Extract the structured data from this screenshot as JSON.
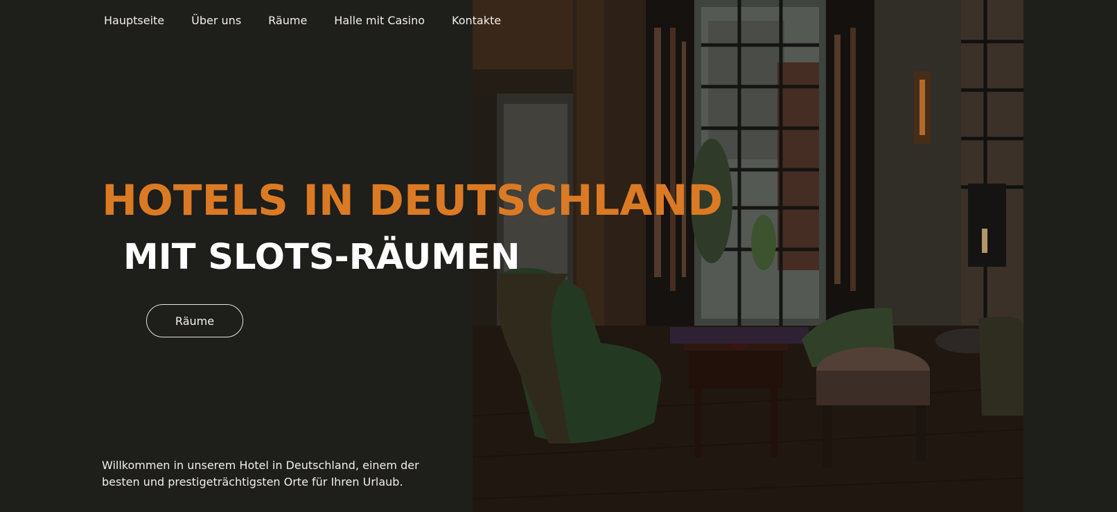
{
  "nav": {
    "items": [
      {
        "label": "Hauptseite"
      },
      {
        "label": "Über uns"
      },
      {
        "label": "Räume"
      },
      {
        "label": "Halle mit Casino"
      },
      {
        "label": "Kontakte"
      }
    ]
  },
  "hero": {
    "title_line1": "HOTELS IN DEUTSCHLAND",
    "title_line2": "MIT SLOTS-RÄUMEN",
    "cta_label": "Räume",
    "intro": "Willkommen in unserem Hotel in Deutschland, einem der besten und prestigeträchtigsten Orte für Ihren Urlaub."
  },
  "colors": {
    "background": "#1e1e1a",
    "accent": "#db7a24",
    "text": "#f2f0ea"
  }
}
